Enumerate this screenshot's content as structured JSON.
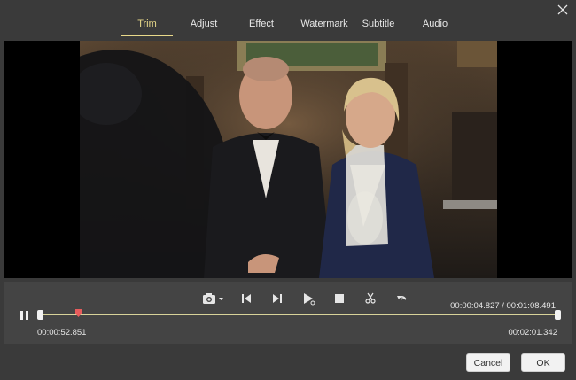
{
  "tabs": [
    {
      "label": "Trim",
      "active": true
    },
    {
      "label": "Adjust"
    },
    {
      "label": "Effect"
    },
    {
      "label": "Watermark"
    },
    {
      "label": "Subtitle"
    },
    {
      "label": "Audio"
    }
  ],
  "icons": {
    "close": "close-icon",
    "snapshot": "camera-icon",
    "prev_frame": "previous-frame-icon",
    "next_frame": "next-frame-icon",
    "play_segment": "play-segment-icon",
    "stop": "stop-icon",
    "cut": "scissors-icon",
    "undo": "undo-icon",
    "pause": "pause-icon"
  },
  "player": {
    "current_time": "00:00:04.827 / 00:01:08.491",
    "start_time": "00:00:52.851",
    "end_time": "00:02:01.342",
    "playhead_fraction": 0.07
  },
  "footer": {
    "cancel_label": "Cancel",
    "ok_label": "OK"
  },
  "colors": {
    "accent": "#e9d98a",
    "track": "#d9d39a",
    "playhead": "#e85c5c",
    "background": "#3a3a3a"
  }
}
